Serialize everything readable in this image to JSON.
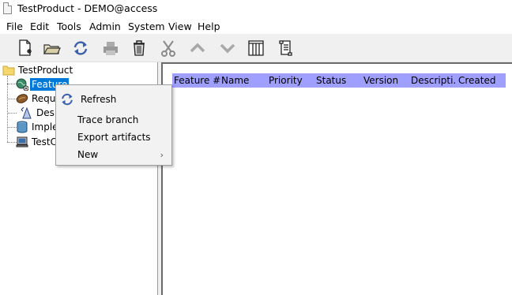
{
  "window": {
    "title": "TestProduct - DEMO@access"
  },
  "menubar": {
    "items": [
      "File",
      "Edit",
      "Tools",
      "Admin",
      "System",
      "View",
      "Help"
    ]
  },
  "toolbar": {
    "buttons": [
      "new-document-icon",
      "open-folder-icon",
      "refresh-icon",
      "print-icon",
      "delete-icon",
      "cut-icon",
      "move-up-icon",
      "move-down-icon",
      "columns-icon",
      "scroll-icon"
    ]
  },
  "tree": {
    "root": "TestProduct",
    "items": [
      {
        "label": "Feature",
        "icon": "feature-globe-icon",
        "selected": true
      },
      {
        "label": "Requi",
        "icon": "requirement-icon"
      },
      {
        "label": "Desi",
        "icon": "design-icon"
      },
      {
        "label": "Imple",
        "icon": "implementation-icon"
      },
      {
        "label": "TestCa",
        "icon": "testcase-computer-icon"
      }
    ]
  },
  "table": {
    "columns": [
      "Feature #",
      "Name",
      "Priority",
      "Status",
      "Version",
      "Descripti...",
      "Created"
    ]
  },
  "context_menu": {
    "items": [
      {
        "label": "Refresh",
        "icon": "refresh-icon"
      },
      {
        "label": "Trace branch"
      },
      {
        "label": "Export artifacts"
      },
      {
        "label": "New",
        "submenu": true
      }
    ],
    "submenu_arrow": "›"
  },
  "colors": {
    "selection": "#0078d7",
    "table_header": "#9f9fff"
  }
}
